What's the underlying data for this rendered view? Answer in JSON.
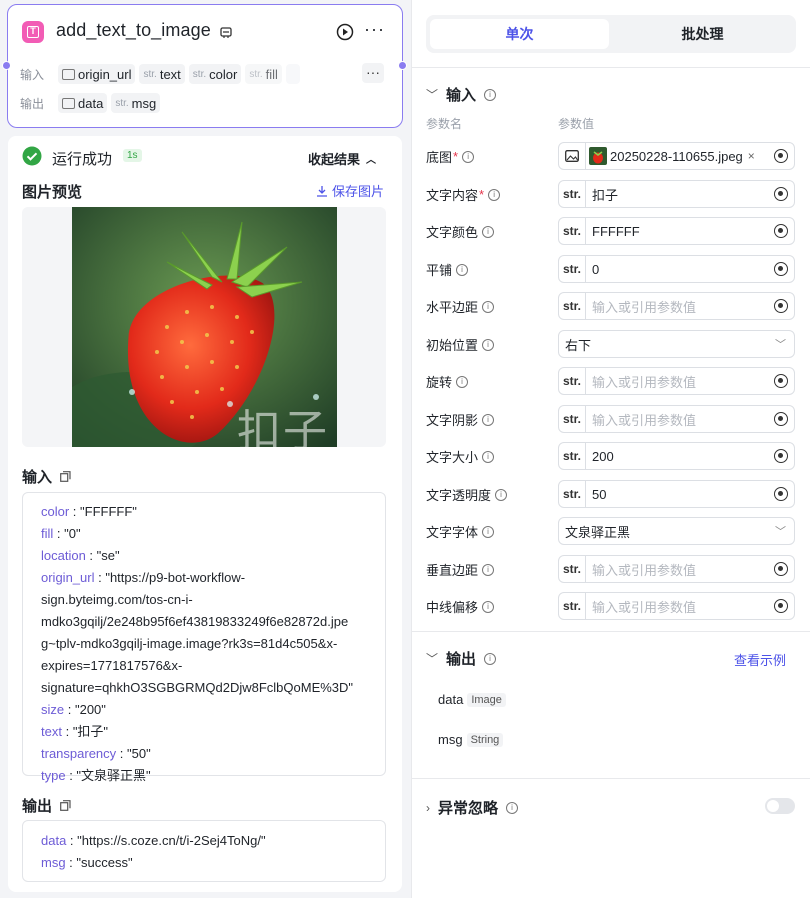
{
  "node": {
    "title": "add_text_to_image",
    "input_label": "输入",
    "output_label": "输出",
    "inputs": [
      {
        "type": "image",
        "name": "origin_url"
      },
      {
        "type": "str.",
        "name": "text"
      },
      {
        "type": "str.",
        "name": "color"
      },
      {
        "type": "str.",
        "name": "fill"
      }
    ],
    "outputs": [
      {
        "type": "image",
        "name": "data"
      },
      {
        "type": "str.",
        "name": "msg"
      }
    ]
  },
  "result": {
    "status": "运行成功",
    "duration": "1s",
    "collapse_label": "收起结果",
    "preview_title": "图片预览",
    "save_label": "保存图片",
    "watermark": "扣子",
    "input_title": "输入",
    "input_lines": [
      {
        "key": "color",
        "value": "\"FFFFFF\""
      },
      {
        "key": "fill",
        "value": "\"0\""
      },
      {
        "key": "location",
        "value": "\"se\""
      },
      {
        "key": "origin_url",
        "value": "\"https://p9-bot-workflow-sign.byteimg.com/tos-cn-i-mdko3gqilj/2e248b95f6ef43819833249f6e82872d.jpeg~tplv-mdko3gqilj-image.image?rk3s=81d4c505&x-expires=1771817576&x-signature=qhkhO3SGBGRMQd2Djw8FclbQoME%3D\""
      },
      {
        "key": "size",
        "value": "\"200\""
      },
      {
        "key": "text",
        "value": "\"扣子\""
      },
      {
        "key": "transparency",
        "value": "\"50\""
      },
      {
        "key": "type",
        "value": "\"文泉驿正黑\""
      }
    ],
    "origin_url_wrapped": [
      "\"https://p9-bot-workflow-",
      "sign.byteimg.com/tos-cn-i-",
      "mdko3gqilj/2e248b95f6ef43819833249f6e82872d.jpe",
      "g~tplv-mdko3gqilj-image.image?rk3s=81d4c505&x-",
      "expires=1771817576&x-",
      "signature=qhkhO3SGBGRMQd2Djw8FclbQoME%3D\""
    ],
    "output_title": "输出",
    "output_lines": [
      {
        "key": "data",
        "value": "\"https://s.coze.cn/t/i-2Sej4ToNg/\""
      },
      {
        "key": "msg",
        "value": "\"success\""
      }
    ]
  },
  "panel": {
    "tabs": [
      "单次",
      "批处理"
    ],
    "input_section": "输入",
    "col_name": "参数名",
    "col_value": "参数值",
    "params": [
      {
        "label": "底图",
        "required": true,
        "kind": "image",
        "value": "20250228-110655.jpeg"
      },
      {
        "label": "文字内容",
        "required": true,
        "kind": "str",
        "value": "扣子"
      },
      {
        "label": "文字颜色",
        "required": false,
        "kind": "str",
        "value": "FFFFFF"
      },
      {
        "label": "平铺",
        "required": false,
        "kind": "str",
        "value": "0"
      },
      {
        "label": "水平边距",
        "required": false,
        "kind": "str",
        "value": "",
        "placeholder": "输入或引用参数值"
      },
      {
        "label": "初始位置",
        "required": false,
        "kind": "select",
        "value": "右下"
      },
      {
        "label": "旋转",
        "required": false,
        "kind": "str",
        "value": "",
        "placeholder": "输入或引用参数值"
      },
      {
        "label": "文字阴影",
        "required": false,
        "kind": "str",
        "value": "",
        "placeholder": "输入或引用参数值"
      },
      {
        "label": "文字大小",
        "required": false,
        "kind": "str",
        "value": "200"
      },
      {
        "label": "文字透明度",
        "required": false,
        "kind": "str",
        "value": "50"
      },
      {
        "label": "文字字体",
        "required": false,
        "kind": "select",
        "value": "文泉驿正黑"
      },
      {
        "label": "垂直边距",
        "required": false,
        "kind": "str",
        "value": "",
        "placeholder": "输入或引用参数值"
      },
      {
        "label": "中线偏移",
        "required": false,
        "kind": "str",
        "value": "",
        "placeholder": "输入或引用参数值"
      }
    ],
    "output_section": "输出",
    "view_example": "查看示例",
    "outputs": [
      {
        "name": "data",
        "type": "Image"
      },
      {
        "name": "msg",
        "type": "String"
      }
    ],
    "exception_section": "异常忽略",
    "colors": {
      "accent": "#4d53e8",
      "node_border": "#8a7cf0",
      "success": "#32a645",
      "required": "#e5334a"
    }
  }
}
